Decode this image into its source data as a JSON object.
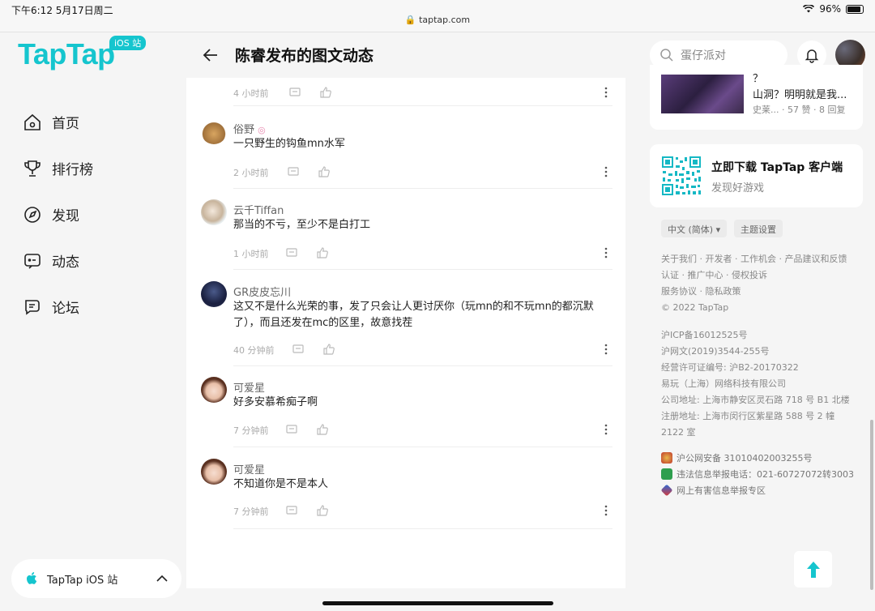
{
  "status_bar": {
    "time": "下午6:12  5月17日周二",
    "battery": "96%",
    "url": "taptap.com"
  },
  "sidebar": {
    "logo": "TapTap",
    "logo_badge": "iOS 站",
    "items": [
      {
        "label": "首页",
        "icon": "home-icon"
      },
      {
        "label": "排行榜",
        "icon": "trophy-icon"
      },
      {
        "label": "发现",
        "icon": "discover-icon"
      },
      {
        "label": "动态",
        "icon": "feed-icon"
      },
      {
        "label": "论坛",
        "icon": "forum-icon"
      }
    ],
    "store_label": "TapTap iOS 站"
  },
  "header": {
    "title": "陈睿发布的图文动态",
    "search_placeholder": "蛋仔派对"
  },
  "main": {
    "top_meta_time": "4 小时前",
    "comments": [
      {
        "name": "俗野",
        "text": "一只野生的钩鱼mn水军",
        "time": "2 小时前"
      },
      {
        "name": "云千Tiffan",
        "text": "那当的不亏，至少不是白打工",
        "time": "1 小时前"
      },
      {
        "name": "GR皮皮忘川",
        "text": "这又不是什么光荣的事，发了只会让人更讨厌你（玩mn的和不玩mn的都沉默了），而且还发在mc的区里，故意找茬",
        "time": "40 分钟前"
      },
      {
        "name": "可爱星",
        "text": "好多安慕希痴子啊",
        "time": "7 分钟前"
      },
      {
        "name": "可爱星",
        "text": "不知道你是不是本人",
        "time": "7 分钟前"
      }
    ]
  },
  "right": {
    "trend": {
      "line1": "？",
      "line2": "山洞？明明就是我...",
      "author": "史莱...",
      "stats": "· 57 赞 · 8 回复"
    },
    "download": {
      "title": "立即下载 TapTap 客户端",
      "subtitle": "发现好游戏"
    },
    "lang_button": "中文 (简体) ▾",
    "theme_button": "主题设置",
    "links1": "关于我们 · 开发者 · 工作机会 · 产品建议和反馈",
    "links2": "认证 · 推广中心 · 侵权投诉",
    "links3": "服务协议 · 隐私政策",
    "copyright": "© 2022 TapTap",
    "icp": "沪ICP备16012525号",
    "wenwang": "沪网文(2019)3544-255号",
    "license": "经营许可证编号: 沪B2-20170322",
    "company": "易玩（上海）网络科技有限公司",
    "addr_office": "公司地址: 上海市静安区灵石路 718 号 B1 北楼",
    "addr_reg": "注册地址: 上海市闵行区紫星路 588 号 2 幢 2122 室",
    "police": "沪公网安备 31010402003255号",
    "report_phone": "违法信息举报电话：021-60727072转3003",
    "report_zone": "网上有害信息举报专区"
  }
}
